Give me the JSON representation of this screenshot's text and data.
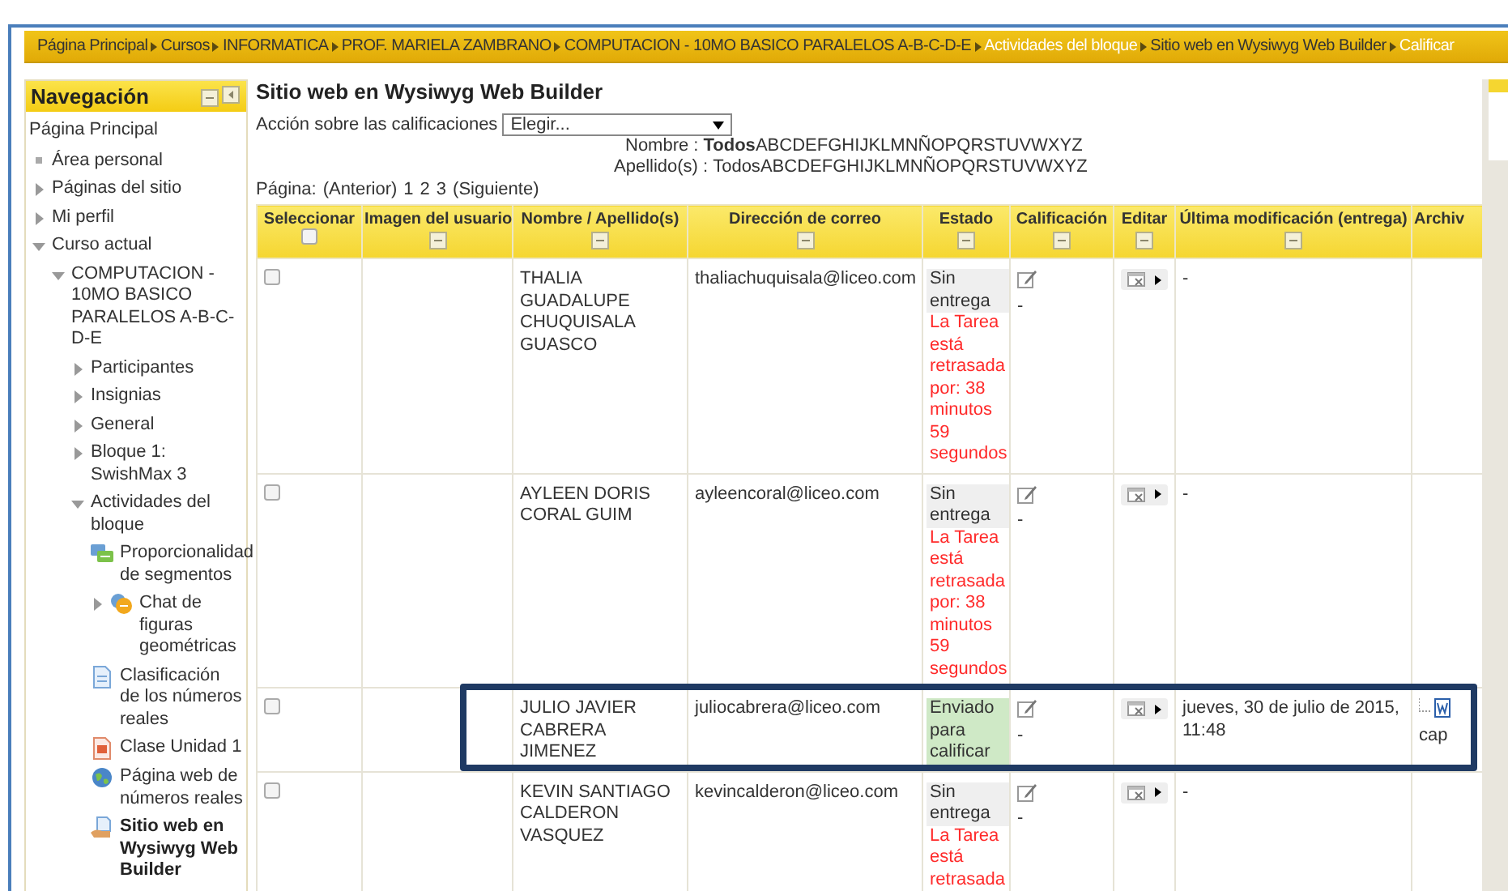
{
  "breadcrumb": [
    {
      "label": "Página Principal",
      "emphasized": false
    },
    {
      "label": "Cursos",
      "emphasized": false
    },
    {
      "label": "INFORMATICA",
      "emphasized": false
    },
    {
      "label": "PROF. MARIELA ZAMBRANO",
      "emphasized": false
    },
    {
      "label": "COMPUTACION - 10MO BASICO PARALELOS A-B-C-D-E",
      "emphasized": false
    },
    {
      "label": "Actividades del bloque",
      "emphasized": true
    },
    {
      "label": "Sitio web en Wysiwyg Web Builder",
      "emphasized": false
    },
    {
      "label": "Calificar",
      "emphasized": true
    }
  ],
  "navigation": {
    "title": "Navegación",
    "home": "Página Principal",
    "items": [
      {
        "label": "Área personal",
        "kind": "bullet"
      },
      {
        "label": "Páginas del sitio",
        "kind": "branch",
        "expanded": false
      },
      {
        "label": "Mi perfil",
        "kind": "branch",
        "expanded": false
      },
      {
        "label": "Curso actual",
        "kind": "branch",
        "expanded": true,
        "children": [
          {
            "label": "COMPUTACION - 10MO BASICO PARALELOS A-B-C-D-E",
            "kind": "branch",
            "expanded": true,
            "children": [
              {
                "label": "Participantes",
                "kind": "branch",
                "expanded": false
              },
              {
                "label": "Insignias",
                "kind": "branch",
                "expanded": false
              },
              {
                "label": "General",
                "kind": "branch",
                "expanded": false
              },
              {
                "label": "Bloque 1: SwishMax 3",
                "kind": "branch",
                "expanded": false
              },
              {
                "label": "Actividades del bloque",
                "kind": "branch",
                "expanded": true,
                "children": [
                  {
                    "label": "Proporcionalidad de segmentos",
                    "kind": "forum",
                    "selected": false
                  },
                  {
                    "label": "Chat de figuras geométricas",
                    "kind": "chat",
                    "expandable": true,
                    "selected": false
                  },
                  {
                    "label": "Clasificación de los números reales",
                    "kind": "file",
                    "selected": false
                  },
                  {
                    "label": "Clase Unidad 1",
                    "kind": "slides",
                    "selected": false
                  },
                  {
                    "label": "Página web de números reales",
                    "kind": "link",
                    "selected": false
                  },
                  {
                    "label": "Sitio web en Wysiwyg Web Builder",
                    "kind": "assignment",
                    "selected": true
                  }
                ]
              }
            ]
          }
        ]
      }
    ]
  },
  "main": {
    "title": "Sitio web en Wysiwyg Web Builder",
    "grading_action": {
      "label": "Acción sobre las calificaciones",
      "value": "Elegir..."
    },
    "name_filter": {
      "label": "Nombre :",
      "options": [
        {
          "label": "Todos",
          "selected": true
        },
        {
          "label": "A",
          "selected": false
        },
        {
          "label": "B",
          "selected": false
        },
        {
          "label": "C",
          "selected": false
        },
        {
          "label": "D",
          "selected": false
        },
        {
          "label": "E",
          "selected": false
        },
        {
          "label": "F",
          "selected": false
        },
        {
          "label": "G",
          "selected": false
        },
        {
          "label": "H",
          "selected": false
        },
        {
          "label": "I",
          "selected": false
        },
        {
          "label": "J",
          "selected": false
        },
        {
          "label": "K",
          "selected": false
        },
        {
          "label": "L",
          "selected": false
        },
        {
          "label": "M",
          "selected": false
        },
        {
          "label": "N",
          "selected": false
        },
        {
          "label": "Ñ",
          "selected": false
        },
        {
          "label": "O",
          "selected": false
        },
        {
          "label": "P",
          "selected": false
        },
        {
          "label": "Q",
          "selected": false
        },
        {
          "label": "R",
          "selected": false
        },
        {
          "label": "S",
          "selected": false
        },
        {
          "label": "T",
          "selected": false
        },
        {
          "label": "U",
          "selected": false
        },
        {
          "label": "V",
          "selected": false
        },
        {
          "label": "W",
          "selected": false
        },
        {
          "label": "X",
          "selected": false
        },
        {
          "label": "Y",
          "selected": false
        },
        {
          "label": "Z",
          "selected": false
        }
      ]
    },
    "surname_filter": {
      "label": "Apellido(s) :",
      "options": [
        {
          "label": "Todos",
          "selected": false
        },
        {
          "label": "A",
          "selected": false
        },
        {
          "label": "B",
          "selected": false
        },
        {
          "label": "C",
          "selected": false
        },
        {
          "label": "D",
          "selected": false
        },
        {
          "label": "E",
          "selected": false
        },
        {
          "label": "F",
          "selected": false
        },
        {
          "label": "G",
          "selected": false
        },
        {
          "label": "H",
          "selected": false
        },
        {
          "label": "I",
          "selected": false
        },
        {
          "label": "J",
          "selected": false
        },
        {
          "label": "K",
          "selected": false
        },
        {
          "label": "L",
          "selected": false
        },
        {
          "label": "M",
          "selected": false
        },
        {
          "label": "N",
          "selected": false
        },
        {
          "label": "Ñ",
          "selected": false
        },
        {
          "label": "O",
          "selected": false
        },
        {
          "label": "P",
          "selected": false
        },
        {
          "label": "Q",
          "selected": false
        },
        {
          "label": "R",
          "selected": false
        },
        {
          "label": "S",
          "selected": false
        },
        {
          "label": "T",
          "selected": false
        },
        {
          "label": "U",
          "selected": false
        },
        {
          "label": "V",
          "selected": false
        },
        {
          "label": "W",
          "selected": false
        },
        {
          "label": "X",
          "selected": false
        },
        {
          "label": "Y",
          "selected": false
        },
        {
          "label": "Z",
          "selected": false
        }
      ]
    },
    "pagination": {
      "label": "Página:",
      "previous": "(Anterior)",
      "pages": [
        "1",
        "2",
        "3"
      ],
      "next": "(Siguiente)"
    },
    "table": {
      "columns": [
        {
          "label": "Seleccionar",
          "kind": "select",
          "checked": false
        },
        {
          "label": "Imagen del usuario",
          "kind": "collapsible"
        },
        {
          "label": "Nombre / Apellido(s)",
          "kind": "collapsible"
        },
        {
          "label": "Dirección de correo",
          "kind": "collapsible"
        },
        {
          "label": "Estado",
          "kind": "collapsible"
        },
        {
          "label": "Calificación",
          "kind": "collapsible"
        },
        {
          "label": "Editar",
          "kind": "collapsible"
        },
        {
          "label": "Última modificación (entrega)",
          "kind": "collapsible"
        },
        {
          "label": "Archiv",
          "kind": "plain"
        }
      ],
      "rows": [
        {
          "checked": false,
          "highlighted": false,
          "name": "THALIA GUADALUPE CHUQUISALA GUASCO",
          "email": "thaliachuquisala@liceo.com",
          "status": {
            "text": "Sin entrega",
            "kind": "missing"
          },
          "late": "La Tarea está retrasada por: 38 minutos 59 segundos",
          "grade": "-",
          "modified": "-"
        },
        {
          "checked": false,
          "highlighted": false,
          "name": "AYLEEN DORIS CORAL GUIM",
          "email": "ayleencoral@liceo.com",
          "status": {
            "text": "Sin entrega",
            "kind": "missing"
          },
          "late": "La Tarea está retrasada por: 38 minutos 59 segundos",
          "grade": "-",
          "modified": "-"
        },
        {
          "checked": false,
          "highlighted": true,
          "name": "JULIO JAVIER CABRERA JIMENEZ",
          "email": "juliocabrera@liceo.com",
          "status": {
            "text": "Enviado para calificar",
            "kind": "submitted"
          },
          "grade": "-",
          "modified": "jueves, 30 de julio de 2015, 11:48",
          "file": "cap"
        },
        {
          "checked": false,
          "highlighted": false,
          "name": "KEVIN SANTIAGO CALDERON VASQUEZ",
          "email": "kevincalderon@liceo.com",
          "status": {
            "text": "Sin entrega",
            "kind": "missing"
          },
          "late": "La Tarea está retrasada",
          "grade": "-",
          "modified": "-"
        }
      ]
    }
  }
}
